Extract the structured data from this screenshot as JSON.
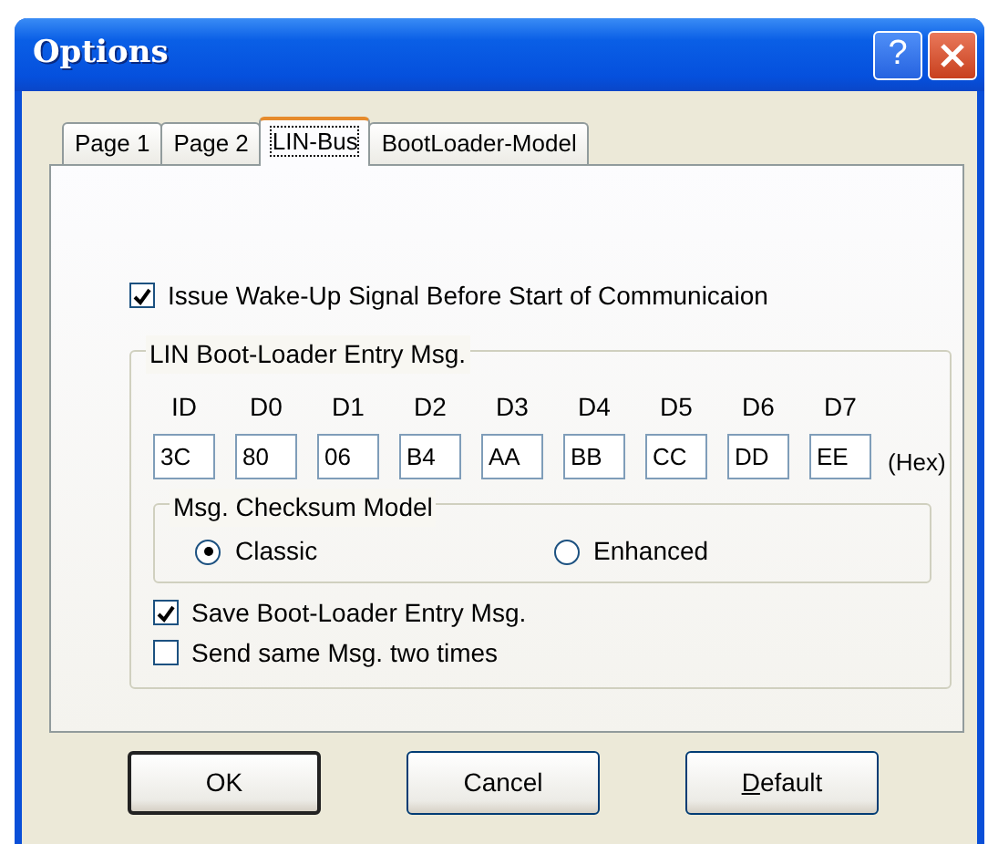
{
  "window": {
    "title": "Options",
    "title_buttons": [
      {
        "kind": "help",
        "label": "?"
      },
      {
        "kind": "close"
      }
    ]
  },
  "tabs": [
    {
      "label": "Page 1",
      "selected": false
    },
    {
      "label": "Page 2",
      "selected": false
    },
    {
      "label": "LIN-Bus",
      "selected": true
    },
    {
      "label": "BootLoader-Model",
      "selected": false
    }
  ],
  "wake_up": {
    "label": "Issue Wake-Up Signal Before Start of Communicaion",
    "checked": true
  },
  "entry_msg": {
    "title": "LIN Boot-Loader Entry Msg.",
    "bytes": [
      {
        "label": "ID",
        "value": "3C"
      },
      {
        "label": "D0",
        "value": "80"
      },
      {
        "label": "D1",
        "value": "06"
      },
      {
        "label": "D2",
        "value": "B4"
      },
      {
        "label": "D3",
        "value": "AA"
      },
      {
        "label": "D4",
        "value": "BB"
      },
      {
        "label": "D5",
        "value": "CC"
      },
      {
        "label": "D6",
        "value": "DD"
      },
      {
        "label": "D7",
        "value": "EE"
      }
    ],
    "unit": "(Hex)",
    "checksum": {
      "title": "Msg. Checksum Model",
      "options": [
        {
          "label": "Classic",
          "selected": true
        },
        {
          "label": "Enhanced",
          "selected": false
        }
      ]
    },
    "options": [
      {
        "label": "Save Boot-Loader Entry Msg.",
        "checked": true
      },
      {
        "label": "Send same Msg. two times",
        "checked": false
      }
    ]
  },
  "buttons": [
    {
      "label": "OK",
      "default": true,
      "mnemonic": false
    },
    {
      "label": "Cancel",
      "default": false,
      "mnemonic": false
    },
    {
      "label": "Default",
      "default": false,
      "mnemonic": true
    }
  ]
}
